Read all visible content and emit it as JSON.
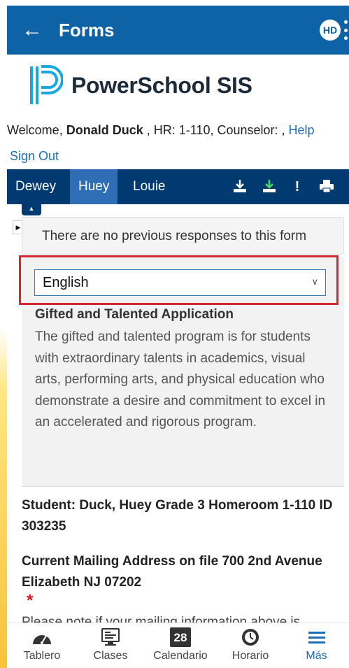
{
  "appbar": {
    "title": "Forms",
    "avatar_initials": "HD"
  },
  "brand": {
    "name": "PowerSchool SIS"
  },
  "header": {
    "welcome_prefix": "Welcome,",
    "user_name": "Donald Duck",
    "hr_text": ", HR: 1-110, Counselor: ,",
    "help_label": "Help",
    "signout_label": "Sign Out"
  },
  "student_tabs": [
    "Dewey",
    "Huey",
    "Louie"
  ],
  "active_tab": "Huey",
  "form": {
    "no_responses_text": "There are no previous responses to this form",
    "language_selected": "English",
    "title": "Gifted and Talented Application",
    "description": "The gifted and talented program is for students with extraordinary talents in academics, visual arts, performing arts, and physical education who demonstrate a desire and commitment to excel in an accelerated and rigorous program.",
    "student_line": "Student: Duck, Huey Grade 3 Homeroom 1-110 ID 303235",
    "address_line": "Current Mailing Address on file 700 2nd Avenue Elizabeth NJ 07202",
    "required_mark": "*",
    "partial_text": "Please note if your mailing information above is"
  },
  "bottom_nav": {
    "items": [
      "Tablero",
      "Clases",
      "Calendario",
      "Horario",
      "Más"
    ],
    "calendar_day": "28",
    "active": "Más"
  },
  "colors": {
    "appbar": "#0d63a5",
    "tabbar": "#003a70",
    "active_tab": "#2f6db5",
    "link": "#1a6eb5",
    "highlight": "#d6262f",
    "required": "#e0101b"
  }
}
